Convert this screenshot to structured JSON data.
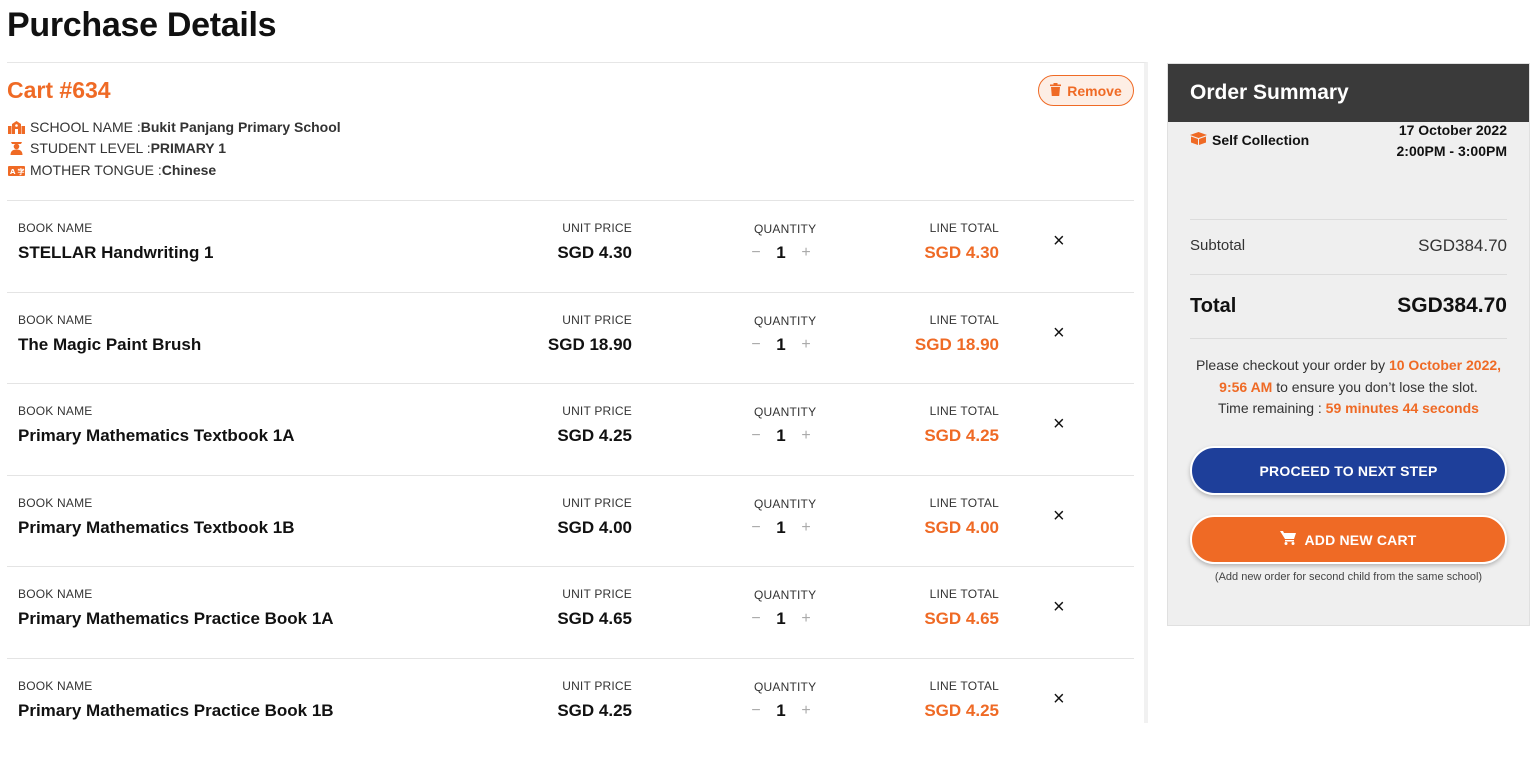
{
  "page": {
    "title": "Purchase Details"
  },
  "cart": {
    "title": "Cart #634",
    "remove_label": "Remove",
    "school_label": "SCHOOL NAME : ",
    "school_value": "Bukit Panjang Primary School",
    "level_label": "STUDENT LEVEL : ",
    "level_value": "PRIMARY 1",
    "tongue_label": "MOTHER TONGUE : ",
    "tongue_value": "Chinese",
    "columns": {
      "book": "BOOK NAME",
      "price": "UNIT PRICE",
      "qty": "QUANTITY",
      "total": "LINE TOTAL"
    },
    "items": [
      {
        "name": "STELLAR Handwriting 1",
        "price": "SGD 4.30",
        "qty": "1",
        "total": "SGD 4.30"
      },
      {
        "name": "The Magic Paint Brush",
        "price": "SGD 18.90",
        "qty": "1",
        "total": "SGD 18.90"
      },
      {
        "name": "Primary Mathematics Textbook 1A",
        "price": "SGD 4.25",
        "qty": "1",
        "total": "SGD 4.25"
      },
      {
        "name": "Primary Mathematics Textbook 1B",
        "price": "SGD 4.00",
        "qty": "1",
        "total": "SGD 4.00"
      },
      {
        "name": "Primary Mathematics Practice Book 1A",
        "price": "SGD 4.65",
        "qty": "1",
        "total": "SGD 4.65"
      },
      {
        "name": "Primary Mathematics Practice Book 1B",
        "price": "SGD 4.25",
        "qty": "1",
        "total": "SGD 4.25"
      }
    ],
    "minus_glyph": "−",
    "plus_glyph": "+",
    "delete_glyph": "×"
  },
  "summary": {
    "title": "Order Summary",
    "collection_label": "Self Collection",
    "collection_date": "17 October 2022",
    "collection_time": "2:00PM - 3:00PM",
    "subtotal_label": "Subtotal",
    "subtotal_value": "SGD384.70",
    "total_label": "Total",
    "total_value": "SGD384.70",
    "note_prefix": "Please checkout your order by ",
    "note_deadline": "10 October 2022, 9:56 AM",
    "note_suffix": " to ensure you don’t lose the slot.",
    "remaining_label": "Time remaining : ",
    "remaining_value": "59 minutes 44 seconds",
    "proceed_label": "PROCEED TO NEXT STEP",
    "add_cart_label": "ADD NEW CART",
    "add_cart_note": "(Add new order for second child from the same school)"
  },
  "icons": {
    "trash": "trash-icon",
    "school": "school-icon",
    "student": "student-icon",
    "language": "language-icon",
    "box": "box-icon",
    "cart": "shopping-cart-icon"
  },
  "colors": {
    "accent": "#ef6a25",
    "primary": "#1e3f9a",
    "summary_header": "#3a3a3a"
  }
}
